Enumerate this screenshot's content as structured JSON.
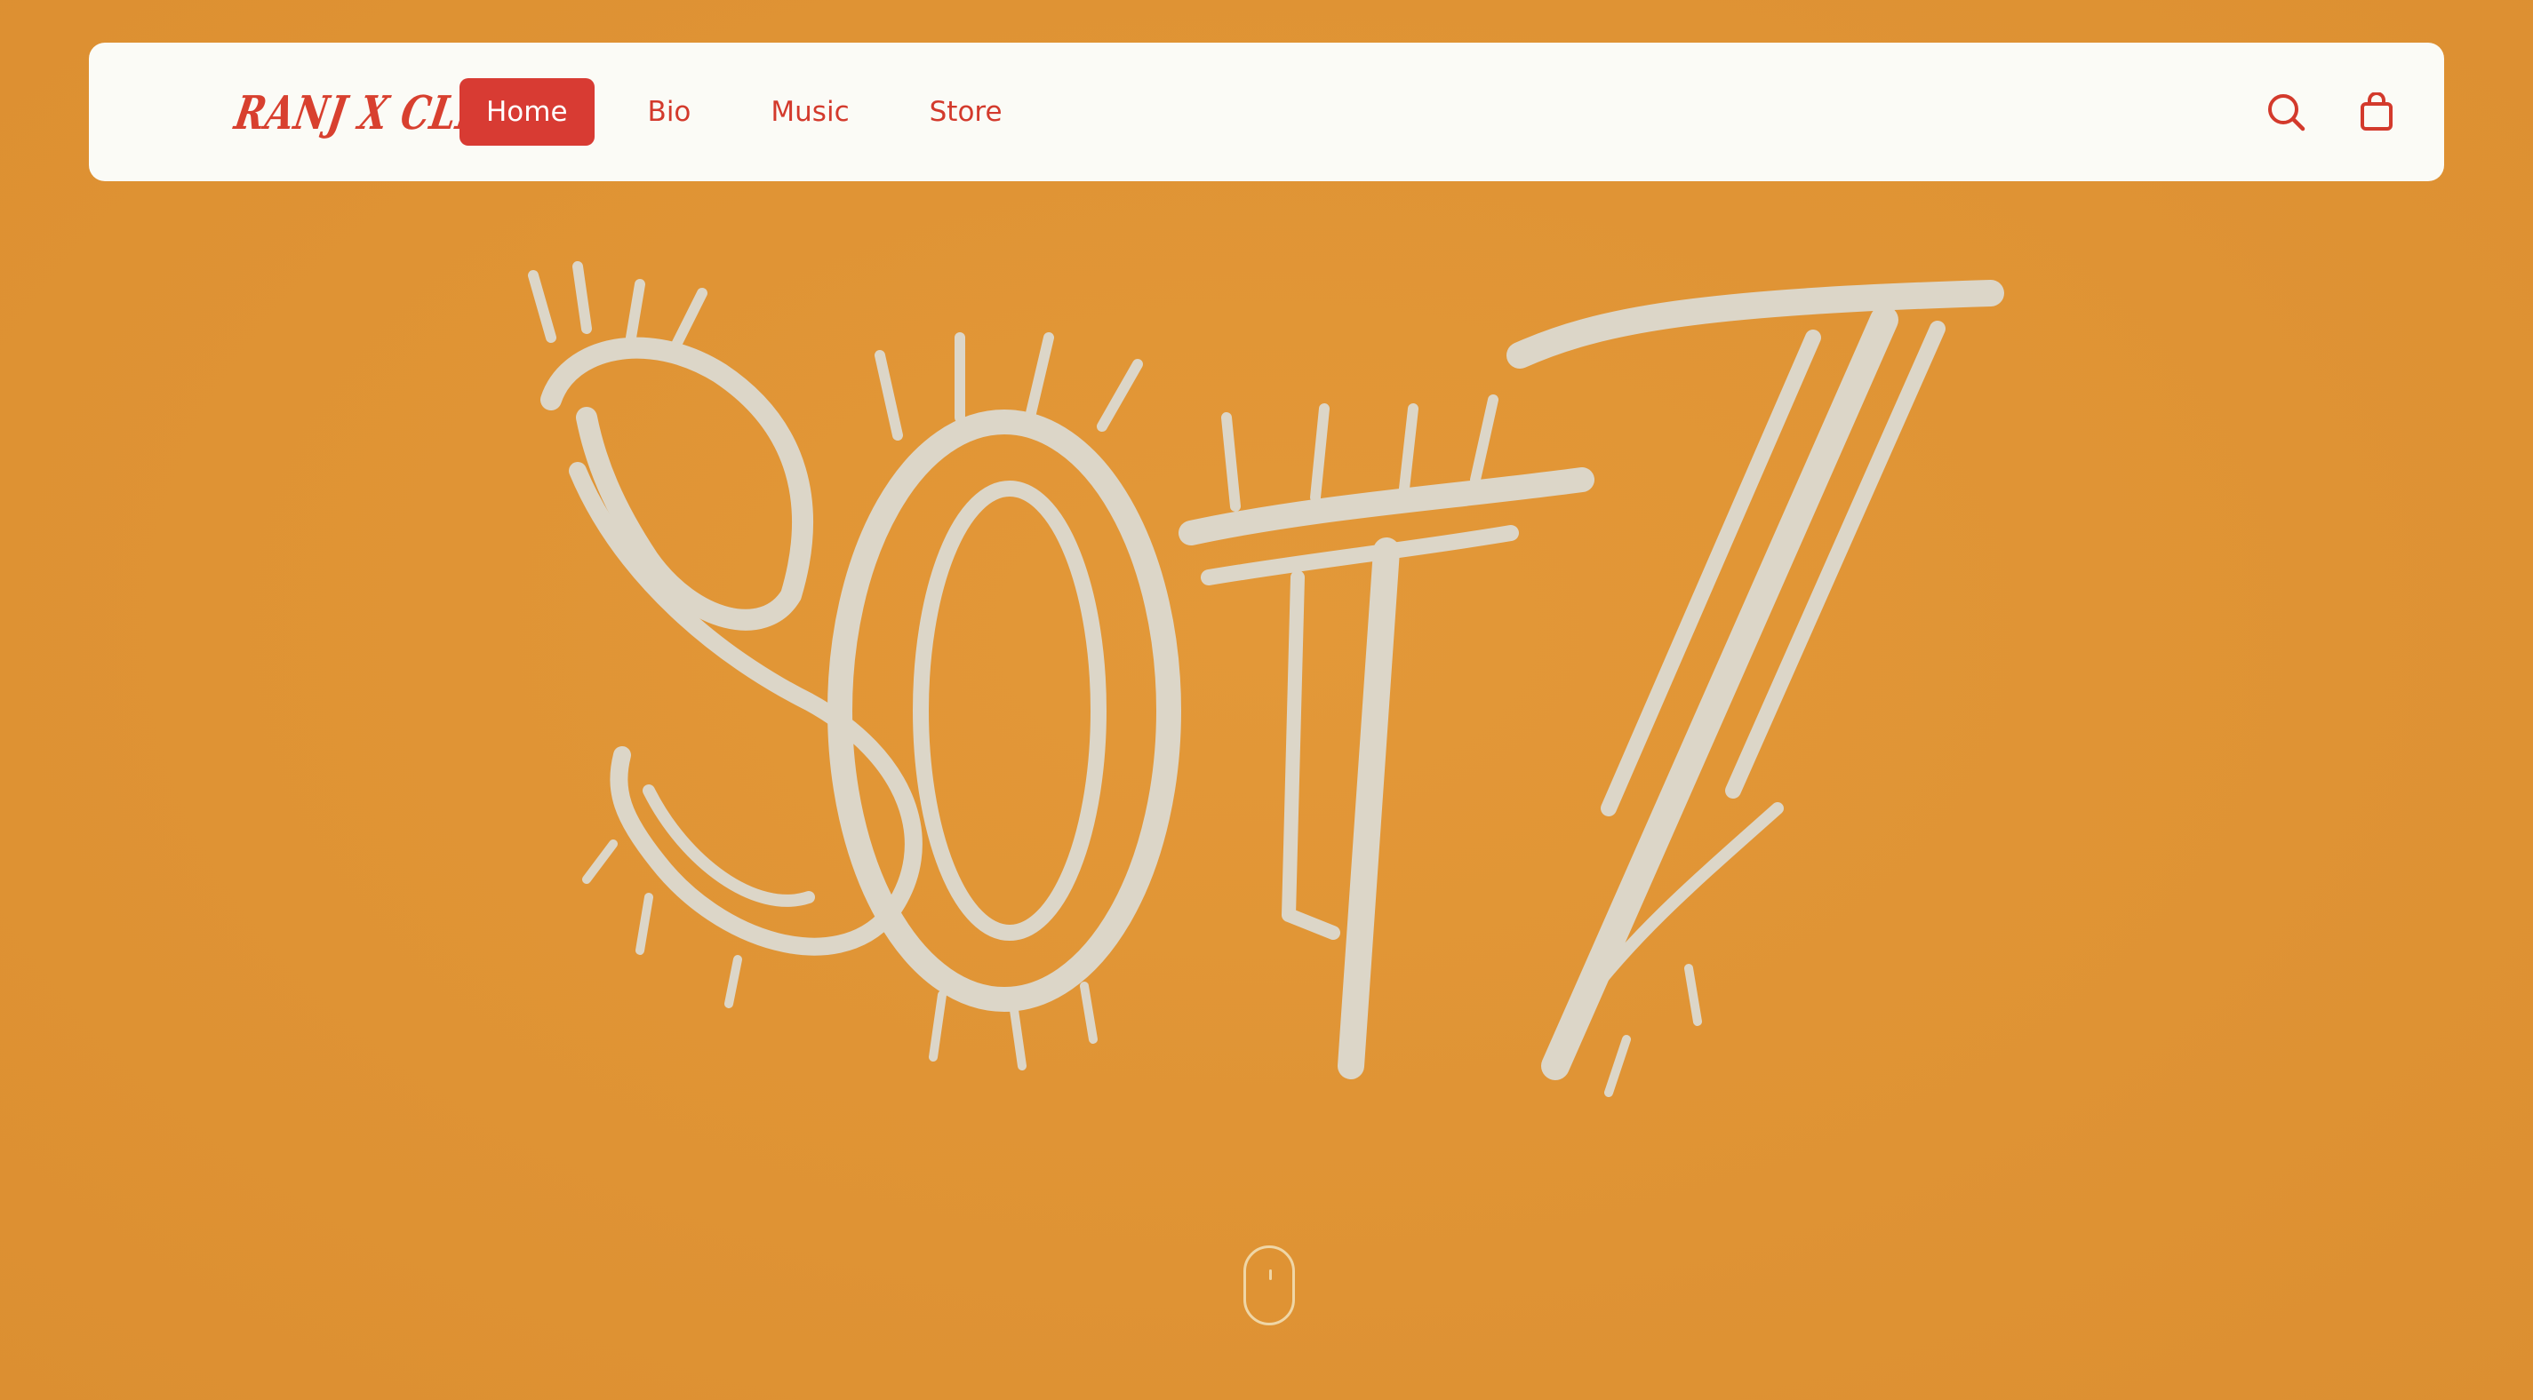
{
  "brand": {
    "logo_text": "RANJ X CLIFR",
    "accent_color": "#d83b33",
    "background_color": "#e09535",
    "artwork_color": "#dcd6c8"
  },
  "nav": {
    "items": [
      {
        "label": "Home",
        "active": true
      },
      {
        "label": "Bio",
        "active": false
      },
      {
        "label": "Music",
        "active": false
      },
      {
        "label": "Store",
        "active": false
      }
    ],
    "icons": [
      "search-icon",
      "shopping-bag-icon"
    ]
  },
  "hero": {
    "artwork_text": "SOTT"
  },
  "scroll_indicator": {
    "icon": "mouse-scroll-icon"
  }
}
